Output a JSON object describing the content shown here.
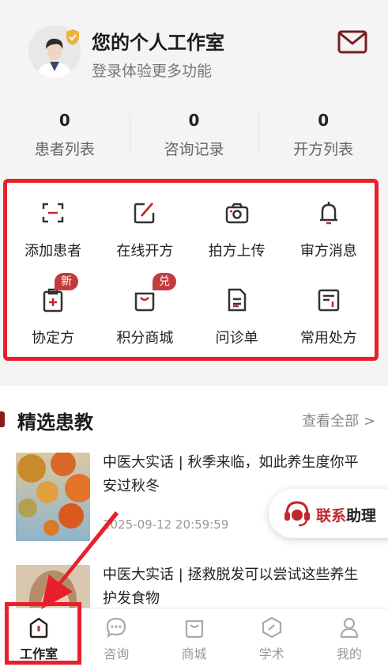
{
  "profile": {
    "title": "您的个人工作室",
    "subtitle": "登录体验更多功能"
  },
  "stats": [
    {
      "value": "0",
      "label": "患者列表"
    },
    {
      "value": "0",
      "label": "咨询记录"
    },
    {
      "value": "0",
      "label": "开方列表"
    }
  ],
  "functions": [
    {
      "label": "添加患者",
      "icon": "scan-icon"
    },
    {
      "label": "在线开方",
      "icon": "edit-icon"
    },
    {
      "label": "拍方上传",
      "icon": "camera-icon"
    },
    {
      "label": "审方消息",
      "icon": "bell-icon"
    },
    {
      "label": "协定方",
      "icon": "medical-doc-icon",
      "badge": "新"
    },
    {
      "label": "积分商城",
      "icon": "shopping-bag-icon",
      "badge": "兑"
    },
    {
      "label": "问诊单",
      "icon": "form-icon"
    },
    {
      "label": "常用处方",
      "icon": "prescription-icon"
    }
  ],
  "education": {
    "title": "精选患教",
    "more": "查看全部 >",
    "articles": [
      {
        "title": "中医大实话 | 秋季来临，如此养生度你平安过秋冬",
        "date": "2025-09-12 20:59:59"
      },
      {
        "title": "中医大实话 | 拯救脱发可以尝试这些养生护发食物",
        "date": ""
      }
    ]
  },
  "assistant": {
    "part1": "联系",
    "part2": "助理"
  },
  "tabs": [
    {
      "label": "工作室",
      "active": true
    },
    {
      "label": "咨询"
    },
    {
      "label": "商城"
    },
    {
      "label": "学术"
    },
    {
      "label": "我的"
    }
  ],
  "colors": {
    "accent": "#c0272d",
    "highlight": "#e8202a"
  }
}
